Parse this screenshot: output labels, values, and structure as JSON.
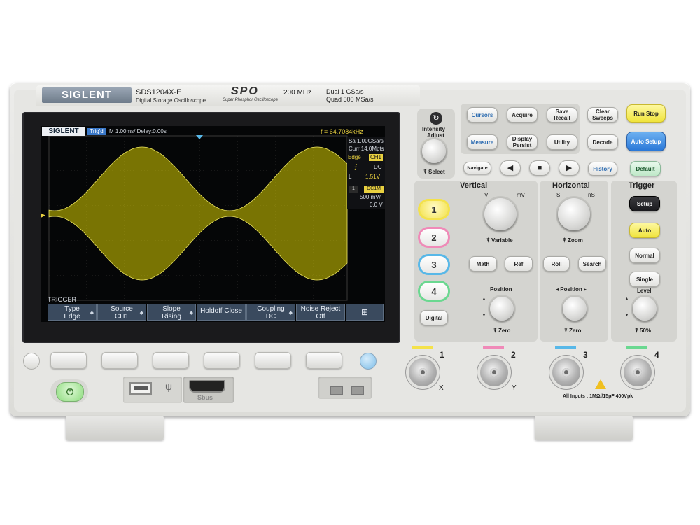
{
  "device": {
    "brand": "SIGLENT",
    "model": "SDS1204X-E",
    "subtitle": "Digital Storage Oscilloscope",
    "spo_logo": "SPO",
    "spo_caption": "Super Phosphor Oscilloscope",
    "bandwidth": "200 MHz",
    "spec_line1": "Dual  1 GSa/s",
    "spec_line2": "Quad  500 MSa/s"
  },
  "screen": {
    "brand": "SIGLENT",
    "trig_state": "Trig'd",
    "timebase": "M 1.00ms/ Delay:0.00s",
    "frequency": "f = 64.7084kHz",
    "sample_rate": "Sa 1.00GSa/s",
    "curr": "Curr 14.0Mpts",
    "trig_type": "Edge",
    "trig_source": "CH1",
    "trig_coupling": "DC",
    "trig_level_label": "L",
    "trig_level": "1.51V",
    "ch_num": "1",
    "ch_coupling": "DC1M",
    "ch_scale": "500 mV/",
    "ch_offset": "0.0 V",
    "menu_title": "TRIGGER",
    "menu": [
      {
        "top": "Type",
        "bottom": "Edge"
      },
      {
        "top": "Source",
        "bottom": "CH1"
      },
      {
        "top": "Slope",
        "bottom": "Rising"
      },
      {
        "top": "Holdoff Close",
        "bottom": ""
      },
      {
        "top": "Coupling",
        "bottom": "DC"
      },
      {
        "top": "Noise Reject",
        "bottom": "Off"
      }
    ],
    "trace_color": "#d8d000"
  },
  "panel": {
    "intensity_label1": "Intensity",
    "intensity_label2": "Adjust",
    "select_label": "Select",
    "top_buttons": [
      "Cursors",
      "Acquire",
      "Save Recall",
      "Clear Sweeps",
      "Run Stop"
    ],
    "mid_buttons": [
      "Measure",
      "Display Persist",
      "Utility",
      "Decode",
      "Auto Setup"
    ],
    "navigate": "Navigate",
    "history": "History",
    "default": "Default",
    "vertical": "Vertical",
    "horizontal": "Horizontal",
    "trigger": "Trigger",
    "v_label": "V",
    "mv_label": "mV",
    "s_label": "S",
    "ns_label": "nS",
    "variable": "Variable",
    "zoom": "Zoom",
    "math": "Math",
    "ref": "Ref",
    "roll": "Roll",
    "search": "Search",
    "position": "Position",
    "h_position": "◂ Position ▸",
    "zero": "Zero",
    "setup": "Setup",
    "auto": "Auto",
    "normal": "Normal",
    "single": "Single",
    "level": "Level",
    "fifty": "50%",
    "channels": [
      "1",
      "2",
      "3",
      "4"
    ],
    "digital": "Digital",
    "inputs_note": "All Inputs : 1MΩ//15pF  400Vpk",
    "x_label": "X",
    "y_label": "Y",
    "colors": {
      "ch1": "#f4e24a",
      "ch2": "#f08ab8",
      "ch3": "#58b8e8",
      "ch4": "#6ad890",
      "run": "#f4ec5a",
      "auto": "#3a8ee0",
      "default": "#bfe8c8",
      "power": "#8cdc7c"
    }
  },
  "ports": {
    "sbus": "Sbus"
  }
}
